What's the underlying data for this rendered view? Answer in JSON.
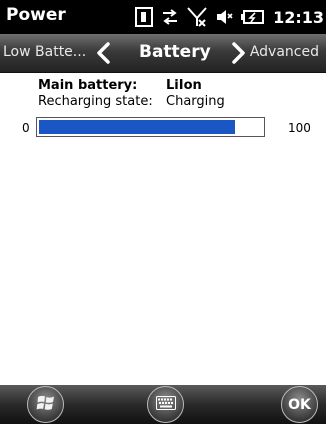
{
  "titlebar": {
    "title": "Power",
    "clock": "12:13",
    "status_icons": [
      "sim-card-icon",
      "data-connection-icon",
      "no-signal-icon",
      "speaker-muted-icon",
      "battery-charging-icon"
    ]
  },
  "tabs": {
    "previous": "Low Batte...",
    "current": "Battery",
    "next": "Advanced"
  },
  "battery": {
    "main_label": "Main battery:",
    "main_value": "LiIon",
    "recharge_label": "Recharging state:",
    "recharge_value": "Charging",
    "min": "0",
    "max": "100",
    "level_fraction": 0.88
  },
  "softkeys": {
    "left": "start-icon",
    "center": "keyboard-icon",
    "right": "OK"
  },
  "colors": {
    "bar_fill": "#1a57c4",
    "titlebar_bg": "#000000"
  }
}
